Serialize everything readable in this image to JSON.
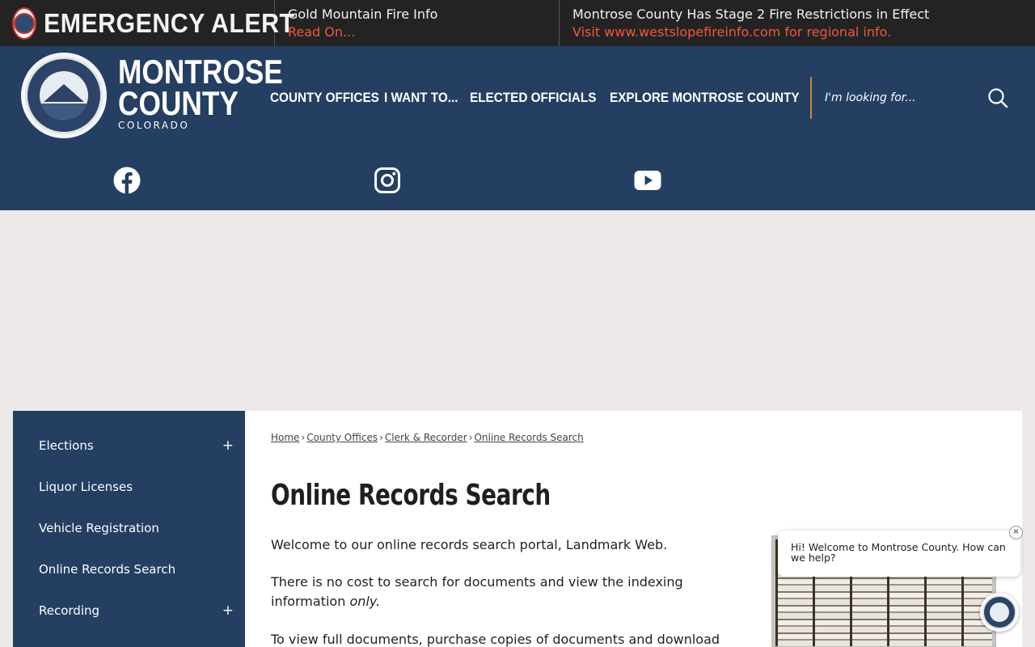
{
  "alert": {
    "title": "EMERGENCY ALERT",
    "items": [
      {
        "title": "Gold Mountain Fire Info",
        "link": "Read On..."
      },
      {
        "title": "Montrose County Has Stage 2 Fire Restrictions in Effect",
        "link": "Visit www.westslopefireinfo.com for regional info."
      }
    ]
  },
  "logo": {
    "line1": "MONTROSE",
    "line2": "COUNTY",
    "line3": "COLORADO"
  },
  "nav": {
    "items": [
      {
        "label": "COUNTY OFFICES"
      },
      {
        "label": "I WANT TO..."
      },
      {
        "label": "ELECTED OFFICIALS"
      },
      {
        "label": "EXPLORE MONTROSE COUNTY"
      }
    ]
  },
  "search": {
    "placeholder": "I'm looking for..."
  },
  "social": [
    {
      "icon": "facebook-icon"
    },
    {
      "icon": "instagram-icon"
    },
    {
      "icon": "youtube-icon"
    }
  ],
  "sidebar": {
    "items": [
      {
        "label": "Elections",
        "expand": "+"
      },
      {
        "label": "Liquor Licenses"
      },
      {
        "label": "Vehicle Registration"
      },
      {
        "label": "Online Records Search"
      },
      {
        "label": "Recording",
        "expand": "+"
      }
    ]
  },
  "breadcrumb": {
    "items": [
      "Home",
      "County Offices",
      "Clerk & Recorder",
      "Online Records Search"
    ],
    "separator": "›"
  },
  "main": {
    "title": "Online Records Search",
    "p1": "Welcome to our online records search portal, Landmark Web.",
    "p2_main": "There is no cost to search for documents and view the indexing information",
    "p2_em": "only.",
    "p3": "To view full documents, purchase copies of documents and download"
  },
  "chat": {
    "message": "Hi! Welcome to Montrose County. How can we help?",
    "close": "×"
  },
  "colors": {
    "header": "#243f61",
    "alert_bar": "#232323",
    "alert_link": "#f0573e",
    "search_divider": "#c98a3c"
  }
}
